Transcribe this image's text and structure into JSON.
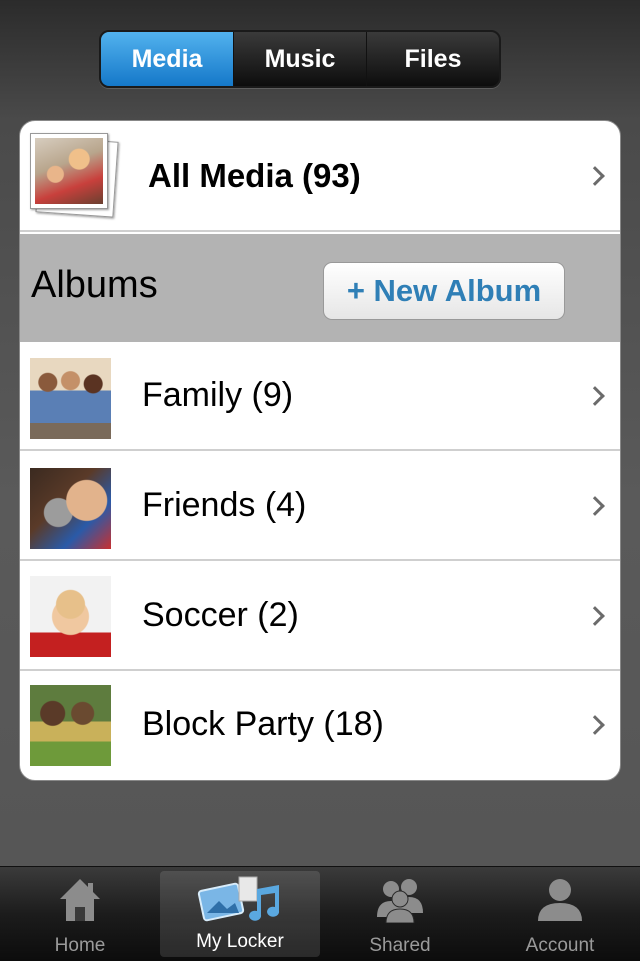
{
  "segmented": {
    "tabs": [
      {
        "label": "Media",
        "active": true
      },
      {
        "label": "Music",
        "active": false
      },
      {
        "label": "Files",
        "active": false
      }
    ]
  },
  "all_media": {
    "label": "All Media (93)"
  },
  "albums": {
    "title": "Albums",
    "new_album_label": "+ New Album",
    "items": [
      {
        "label": "Family (9)"
      },
      {
        "label": "Friends (4)"
      },
      {
        "label": "Soccer (2)"
      },
      {
        "label": "Block Party (18)"
      }
    ]
  },
  "tabbar": {
    "tabs": [
      {
        "label": "Home",
        "icon": "home-icon"
      },
      {
        "label": "My Locker",
        "icon": "locker-icon",
        "active": true
      },
      {
        "label": "Shared",
        "icon": "people-icon"
      },
      {
        "label": "Account",
        "icon": "user-icon"
      }
    ]
  },
  "colors": {
    "accent": "#1f86d6",
    "new_album_text": "#2f7fb6",
    "section_header_bg": "#b3b3b3"
  }
}
